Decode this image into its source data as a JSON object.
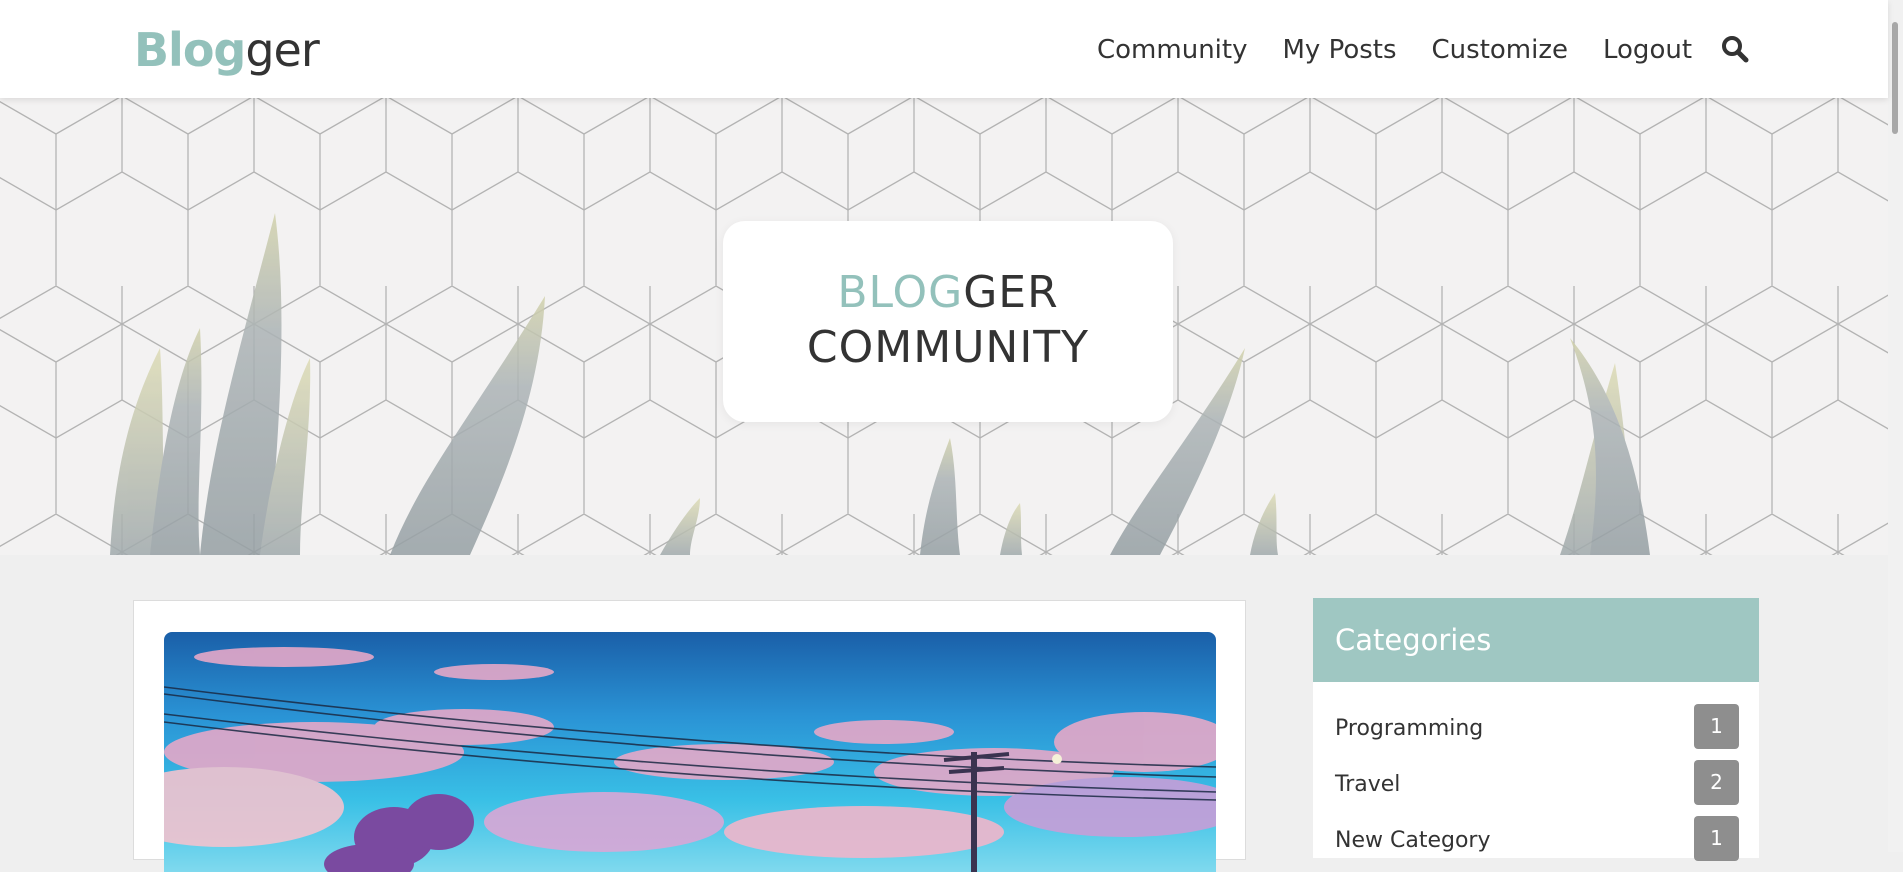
{
  "navbar": {
    "logo_accent": "Blog",
    "logo_rest": "ger",
    "links": [
      "Community",
      "My Posts",
      "Customize",
      "Logout"
    ],
    "search_icon": "search-icon"
  },
  "hero": {
    "title_accent": "BLOG",
    "title_rest": "GER",
    "title_line2": "COMMUNITY"
  },
  "sidebar": {
    "title": "Categories",
    "categories": [
      {
        "name": "Programming",
        "count": "1"
      },
      {
        "name": "Travel",
        "count": "2"
      },
      {
        "name": "New Category",
        "count": "1"
      }
    ]
  },
  "colors": {
    "accent": "#93c1bb",
    "sidebar_header": "#9fc7c2",
    "badge": "#8e8e8e",
    "page_bg": "#efefef"
  }
}
